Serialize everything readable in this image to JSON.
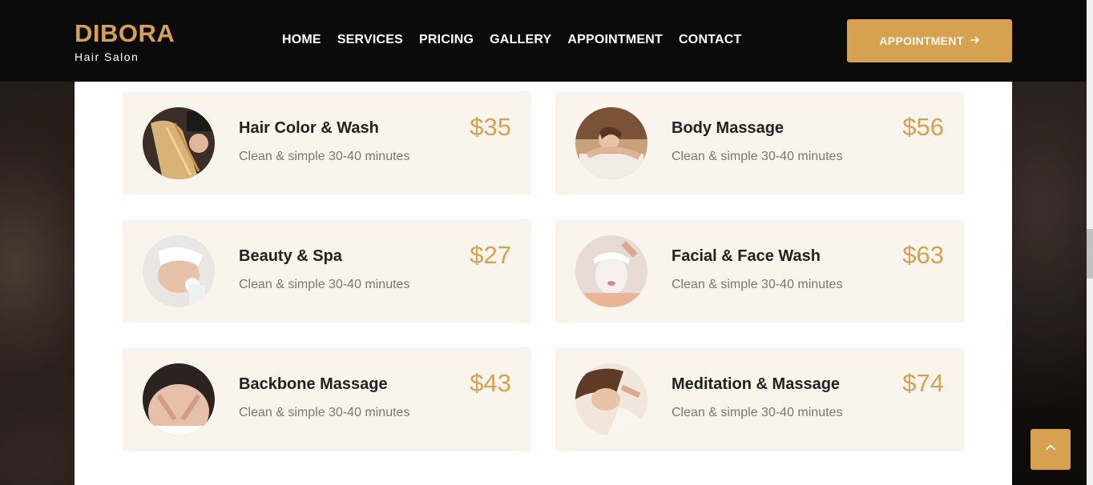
{
  "brand": {
    "name": "DIBORA",
    "tagline": "Hair Salon",
    "accent": "#d6a24f"
  },
  "nav": {
    "items": [
      {
        "label": "HOME"
      },
      {
        "label": "SERVICES"
      },
      {
        "label": "PRICING"
      },
      {
        "label": "GALLERY"
      },
      {
        "label": "APPOINTMENT"
      },
      {
        "label": "CONTACT"
      }
    ]
  },
  "header_cta": {
    "label": "APPOINTMENT",
    "icon": "arrow-right-icon"
  },
  "services": [
    {
      "title": "Hair Color & Wash",
      "desc": "Clean & simple 30-40 minutes",
      "price": "$35",
      "image": "hair-color-photo"
    },
    {
      "title": "Body Massage",
      "desc": "Clean & simple 30-40 minutes",
      "price": "$56",
      "image": "body-massage-photo"
    },
    {
      "title": "Beauty & Spa",
      "desc": "Clean & simple 30-40 minutes",
      "price": "$27",
      "image": "beauty-spa-photo"
    },
    {
      "title": "Facial & Face Wash",
      "desc": "Clean & simple 30-40 minutes",
      "price": "$63",
      "image": "facial-mask-photo"
    },
    {
      "title": "Backbone Massage",
      "desc": "Clean & simple 30-40 minutes",
      "price": "$43",
      "image": "back-massage-photo"
    },
    {
      "title": "Meditation & Massage",
      "desc": "Clean & simple 30-40 minutes",
      "price": "$74",
      "image": "meditation-massage-photo"
    }
  ],
  "scroll_top": {
    "icon": "chevron-up-icon"
  }
}
